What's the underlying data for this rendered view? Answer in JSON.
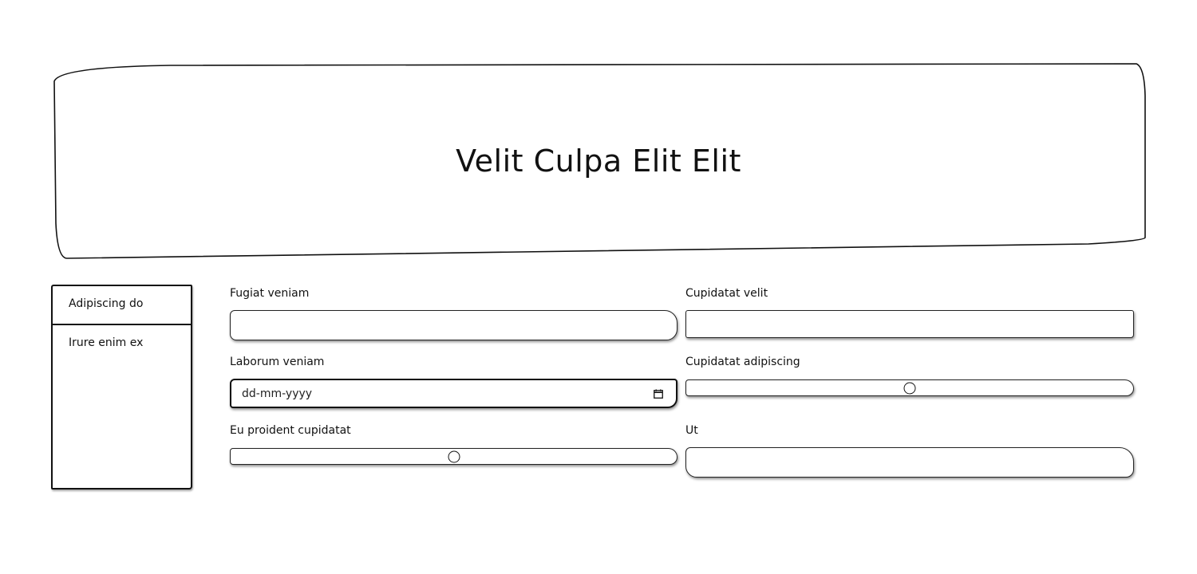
{
  "header": {
    "title": "Velit Culpa Elit Elit"
  },
  "sidebar": {
    "items": [
      {
        "label": "Adipiscing do"
      },
      {
        "label": "Irure enim ex"
      }
    ]
  },
  "form": {
    "fugiat_veniam": {
      "label": "Fugiat veniam",
      "value": ""
    },
    "cupidatat_velit": {
      "label": "Cupidatat velit",
      "value": ""
    },
    "laborum_veniam": {
      "label": "Laborum veniam",
      "placeholder": "dd-mm-yyyy"
    },
    "cupidatat_adipiscing": {
      "label": "Cupidatat adipiscing",
      "value_percent": 50
    },
    "eu_proident_cupidatat": {
      "label": "Eu proident cupidatat",
      "value_percent": 50
    },
    "ut": {
      "label": "Ut",
      "value": ""
    }
  },
  "icons": {
    "calendar": "calendar-icon"
  }
}
